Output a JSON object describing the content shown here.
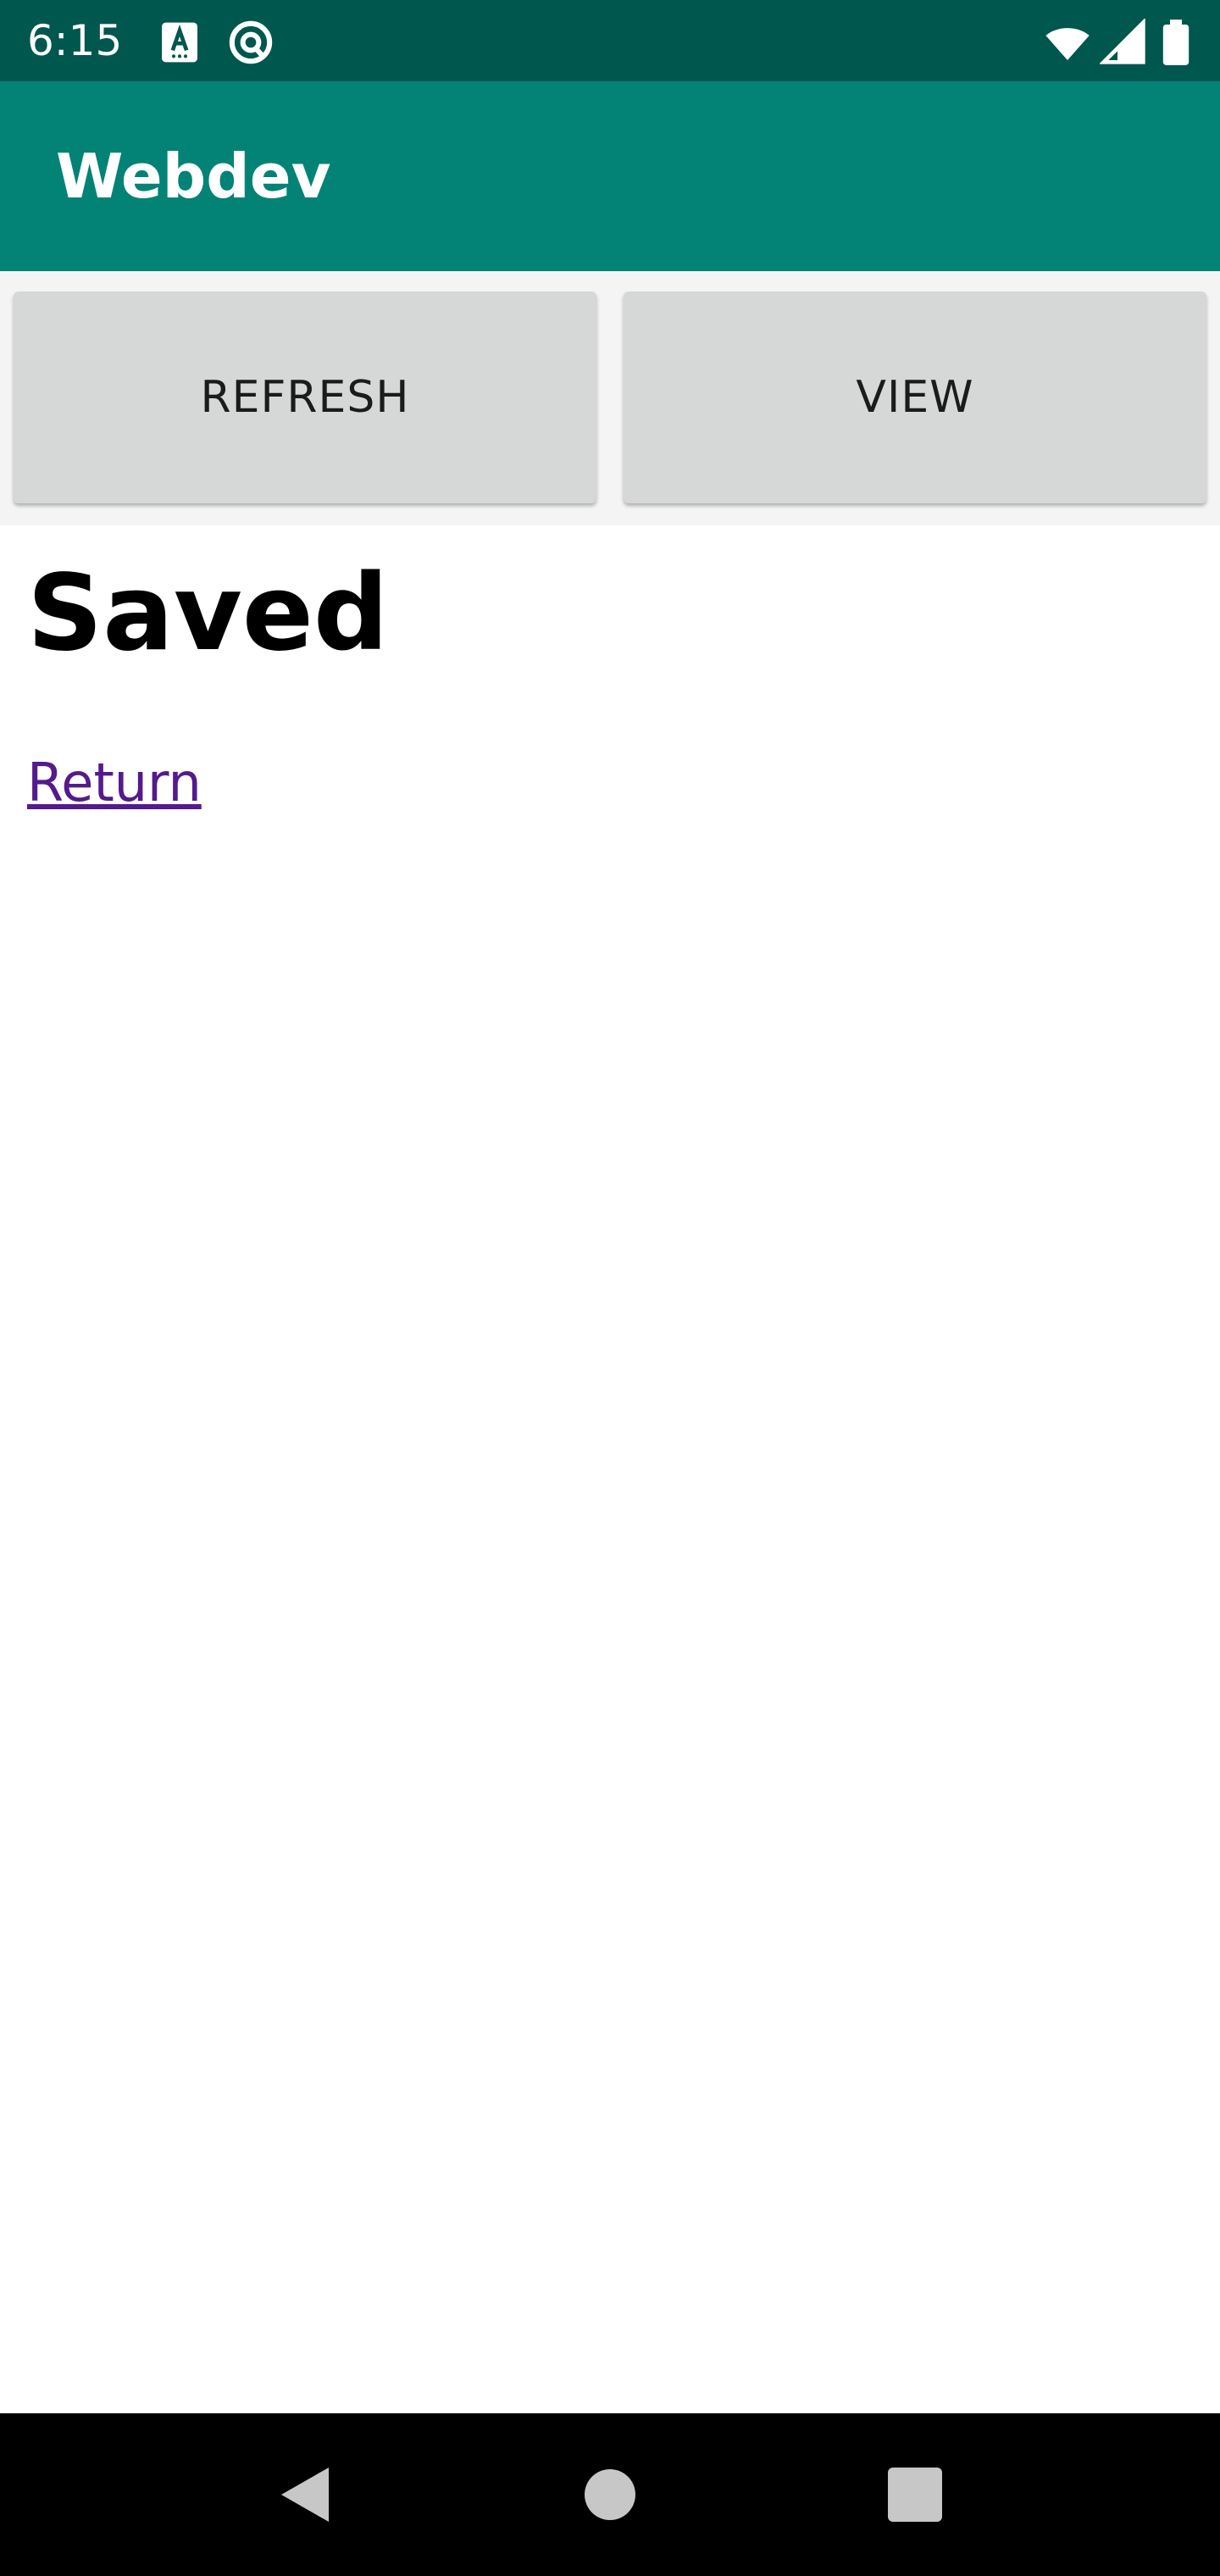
{
  "status_bar": {
    "time": "6:15",
    "left_icons": [
      "a-notification-icon",
      "sync-at-icon"
    ],
    "right_icons": [
      "wifi-icon",
      "cell-signal-icon",
      "battery-icon"
    ],
    "background_color": "#00574d"
  },
  "app_bar": {
    "title": "Webdev",
    "background_color": "#028376"
  },
  "toolbar": {
    "refresh_label": "REFRESH",
    "view_label": "VIEW"
  },
  "content": {
    "heading": "Saved",
    "link_text": "Return",
    "link_color": "#551a8b"
  },
  "nav_bar": {
    "icons": [
      "back-icon",
      "home-icon",
      "recents-icon"
    ]
  }
}
